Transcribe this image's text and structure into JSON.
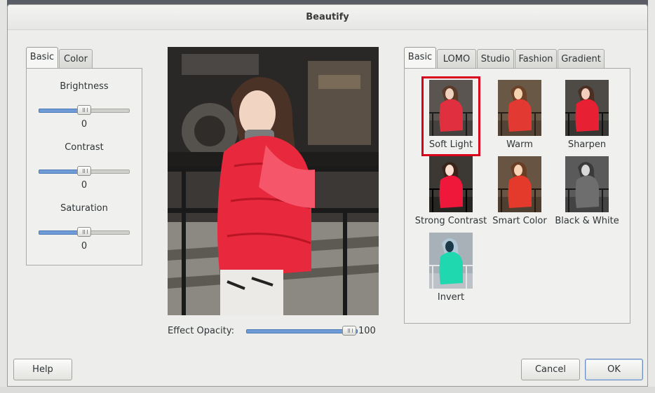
{
  "window": {
    "title": "Beautify"
  },
  "left_tabs": [
    {
      "label": "Basic",
      "active": true
    },
    {
      "label": "Color",
      "active": false
    }
  ],
  "adjustments": [
    {
      "label": "Brightness",
      "value": "0",
      "level": 0
    },
    {
      "label": "Contrast",
      "value": "0",
      "level": 0
    },
    {
      "label": "Saturation",
      "value": "0",
      "level": 0
    }
  ],
  "opacity": {
    "label": "Effect Opacity:",
    "value": "100",
    "level": 1.0
  },
  "right_tabs": [
    {
      "label": "Basic",
      "active": true
    },
    {
      "label": "LOMO",
      "active": false
    },
    {
      "label": "Studio",
      "active": false
    },
    {
      "label": "Fashion",
      "active": false
    },
    {
      "label": "Gradient",
      "active": false
    }
  ],
  "effects": [
    {
      "label": "Soft Light",
      "selected": true,
      "tone": "normal"
    },
    {
      "label": "Warm",
      "selected": false,
      "tone": "warm"
    },
    {
      "label": "Sharpen",
      "selected": false,
      "tone": "sharp"
    },
    {
      "label": "Strong Contrast",
      "selected": false,
      "tone": "contrast"
    },
    {
      "label": "Smart Color",
      "selected": false,
      "tone": "warm2"
    },
    {
      "label": "Black & White",
      "selected": false,
      "tone": "bw"
    },
    {
      "label": "Invert",
      "selected": false,
      "tone": "invert"
    }
  ],
  "buttons": {
    "help": "Help",
    "cancel": "Cancel",
    "ok": "OK"
  },
  "colors": {
    "selection": "#d9001b",
    "slider_fill": "#6f9bd6",
    "jacket": "#e8283c"
  }
}
